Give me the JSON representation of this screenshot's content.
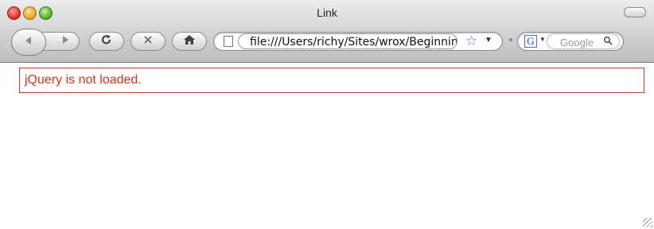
{
  "window": {
    "title": "Link"
  },
  "toolbar": {
    "back_icon": "back-arrow-icon",
    "forward_icon": "forward-arrow-icon",
    "reload_icon": "reload-icon",
    "stop_icon": "stop-icon",
    "home_icon": "home-icon"
  },
  "address": {
    "url": "file:///Users/richy/Sites/wrox/Beginning"
  },
  "search": {
    "engine_letter": "G",
    "placeholder": "Google"
  },
  "page": {
    "message": "jQuery is not loaded."
  },
  "colors": {
    "message_text": "#d4321f",
    "message_border": "#cc3a2a"
  }
}
